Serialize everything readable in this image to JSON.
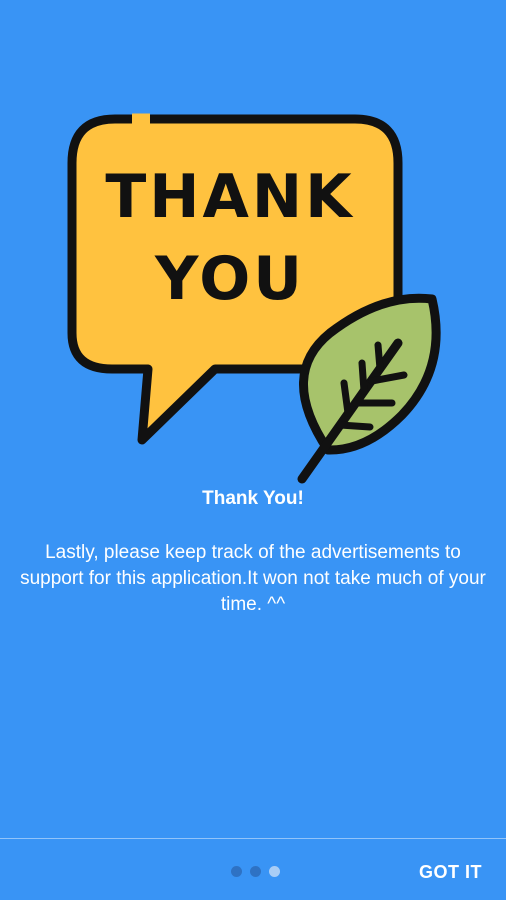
{
  "illustration": {
    "bubble_line1": "THANK",
    "bubble_line2": "YOU",
    "colors": {
      "bubble": "#FFC23F",
      "leaf": "#A7C36B",
      "outline": "#111111"
    }
  },
  "content": {
    "title": "Thank You!",
    "body": "Lastly, please keep track of the advertisements to support for this application.It won not take much of your time. ^^"
  },
  "pager": {
    "total": 3,
    "active_index": 2
  },
  "footer": {
    "got_it_label": "GOT IT"
  },
  "colors": {
    "background": "#3994F5"
  }
}
